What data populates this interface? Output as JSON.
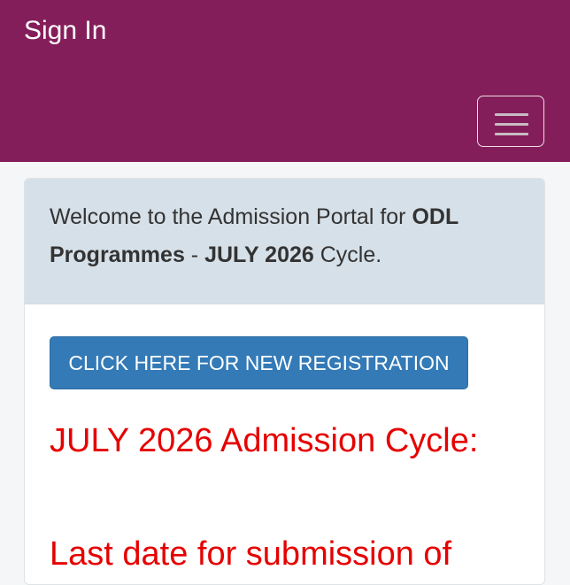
{
  "navbar": {
    "brand": "Sign In",
    "menu_icon": "hamburger-menu-icon",
    "color": "#841e5a"
  },
  "welcome": {
    "prefix": "Welcome to the Admission Portal for ",
    "programme": "ODL Programmes",
    "separator": " - ",
    "cycle": "JULY 2026",
    "suffix": " Cycle."
  },
  "register_button": {
    "label": "CLICK HERE FOR NEW REGISTRATION",
    "color": "#337ab7"
  },
  "notice": {
    "title": "JULY 2026 Admission Cycle:",
    "last_date": "Last date for submission of",
    "color": "#e60000"
  }
}
